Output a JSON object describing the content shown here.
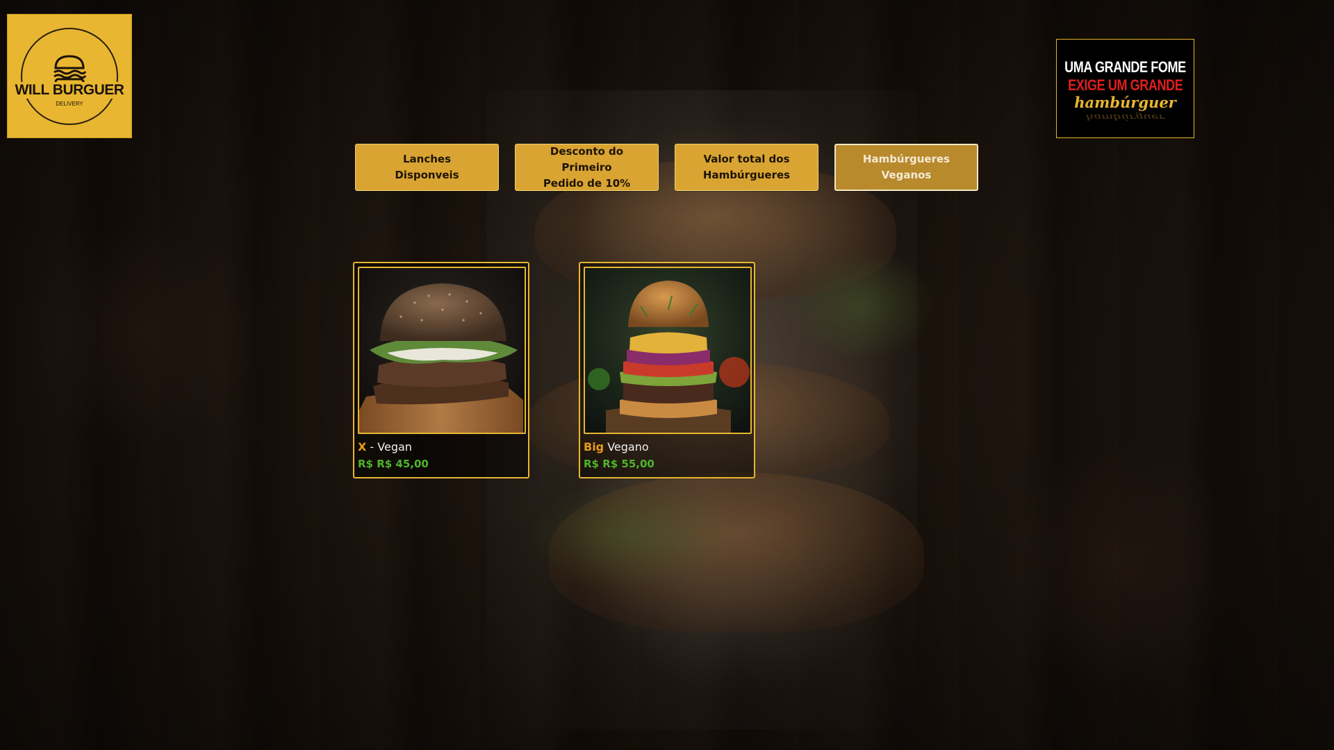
{
  "logo": {
    "name": "WILL BURGUER",
    "subtitle": "DELIVERY",
    "background": "#e8b631"
  },
  "slogan": {
    "line1": "UMA GRANDE FOME",
    "line2": "EXIGE UM GRANDE",
    "line3": "hambúrguer",
    "line1_color": "#ffffff",
    "line2_color": "#e01e1e",
    "line3_color": "#e8b631"
  },
  "nav": {
    "items": [
      {
        "line1": "Lanches",
        "line2": "Disponveis",
        "active": false
      },
      {
        "line1": "Desconto do Primeiro",
        "line2": "Pedido de 10%",
        "active": false
      },
      {
        "line1": "Valor total dos",
        "line2": "Hambúrgueres",
        "active": false
      },
      {
        "line1": "Hambúrgueres",
        "line2": "Veganos",
        "active": true
      }
    ]
  },
  "products": [
    {
      "accent": "X",
      "name": " - Vegan",
      "price": "R$ R$ 45,00",
      "image": "vegan-burger-on-wood-board"
    },
    {
      "accent": "Big",
      "name": " Vegano",
      "price": "R$ R$ 55,00",
      "image": "stacked-veggie-burger"
    }
  ],
  "colors": {
    "accent_gold": "#e8b631",
    "button_gold": "#d9a431",
    "price_green": "#4fb52a",
    "title_orange": "#e89a1a"
  }
}
